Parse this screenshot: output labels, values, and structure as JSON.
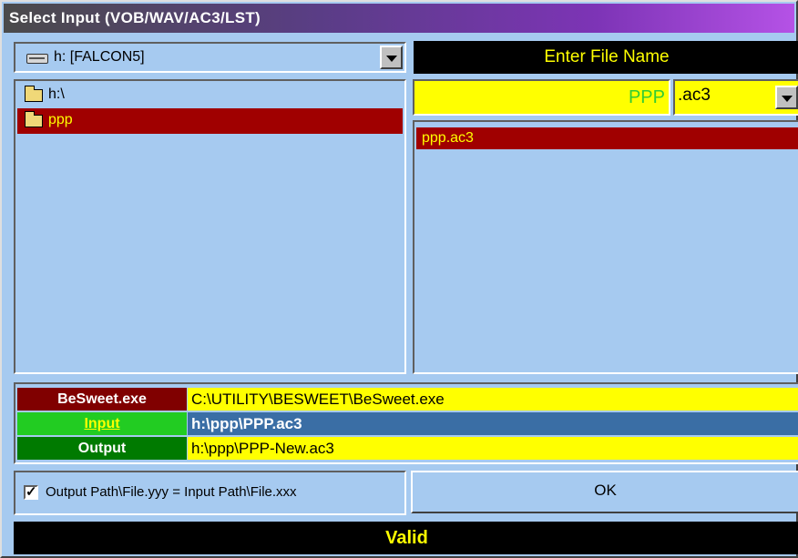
{
  "window": {
    "title": "Select Input (VOB/WAV/AC3/LST)"
  },
  "drive": {
    "selected": "h: [FALCON5]"
  },
  "directories": [
    {
      "label": "h:\\",
      "selected": false
    },
    {
      "label": "ppp",
      "selected": true
    }
  ],
  "file_name": {
    "header": "Enter File Name",
    "value": "PPP",
    "extension": ".ac3"
  },
  "files": [
    {
      "label": "ppp.ac3",
      "selected": true
    }
  ],
  "paths": {
    "besweet_label": "BeSweet.exe",
    "besweet_value": "C:\\UTILITY\\BESWEET\\BeSweet.exe",
    "input_label": "Input",
    "input_value": "h:\\ppp\\PPP.ac3",
    "output_label": "Output",
    "output_value": "h:\\ppp\\PPP-New.ac3"
  },
  "options": {
    "same_path_label": "Output Path\\File.yyy = Input Path\\File.xxx",
    "same_path_checked": true
  },
  "buttons": {
    "ok": "OK"
  },
  "status": {
    "text": "Valid"
  },
  "colors": {
    "panel": "#a6caf0",
    "highlight": "#a00000",
    "field": "#ffff00",
    "status_bg": "#000000"
  }
}
